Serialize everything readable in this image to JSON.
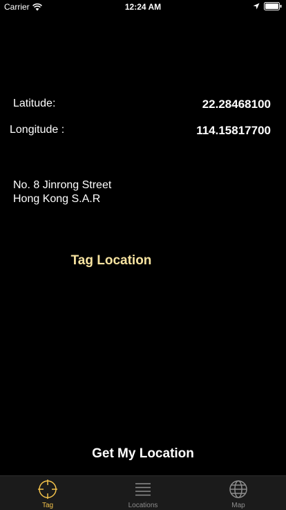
{
  "status_bar": {
    "carrier": "Carrier",
    "time": "12:24 AM"
  },
  "coordinates": {
    "latitude_label": "Latitude:",
    "latitude_value": "22.28468100",
    "longitude_label": "Longitude :",
    "longitude_value": "114.15817700"
  },
  "address": {
    "line1": "No. 8 Jinrong Street",
    "line2": "Hong Kong S.A.R"
  },
  "actions": {
    "tag_label": "Tag Location",
    "get_location_label": "Get My Location"
  },
  "tab_bar": {
    "tabs": [
      {
        "label": "Tag",
        "icon": "crosshair-icon",
        "active": true
      },
      {
        "label": "Locations",
        "icon": "list-icon",
        "active": false
      },
      {
        "label": "Map",
        "icon": "globe-icon",
        "active": false
      }
    ]
  },
  "colors": {
    "background": "#000000",
    "accent": "#f2c14a",
    "tag_button": "#f7e3a0",
    "inactive_tab": "#8e8e8e"
  }
}
